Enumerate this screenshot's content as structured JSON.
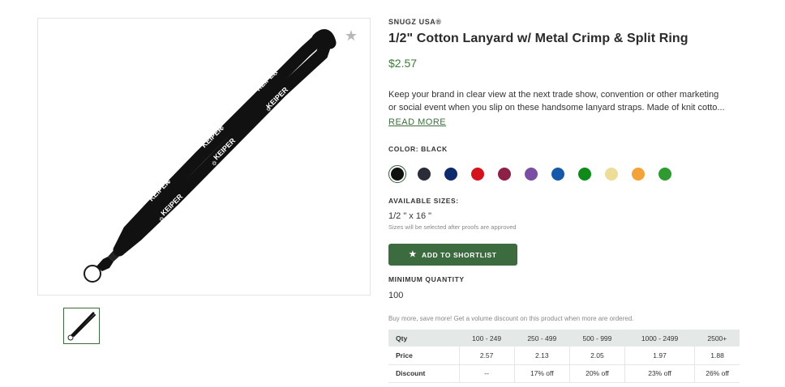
{
  "product": {
    "brand": "SNUGZ USA®",
    "title": "1/2\" Cotton Lanyard w/ Metal Crimp & Split Ring",
    "price": "$2.57",
    "description_line1": "Keep your brand in clear view at the next trade show, convention or other marketing",
    "description_line2": "or social event when you slip on these handsome lanyard straps. Made of knit cotto...",
    "read_more_label": "READ MORE",
    "imprint_text": "KEIPER",
    "favorite_icon": "star-icon",
    "lanyard_color": "#111111"
  },
  "color": {
    "label": "COLOR: BLACK",
    "swatches": [
      {
        "name": "black",
        "hex": "#111111",
        "selected": true
      },
      {
        "name": "dark-gray",
        "hex": "#2a2c38",
        "selected": false
      },
      {
        "name": "navy",
        "hex": "#0f2a6b",
        "selected": false
      },
      {
        "name": "red",
        "hex": "#d4131c",
        "selected": false
      },
      {
        "name": "maroon",
        "hex": "#8c2046",
        "selected": false
      },
      {
        "name": "purple",
        "hex": "#7a4ea3",
        "selected": false
      },
      {
        "name": "royal-blue",
        "hex": "#1659a8",
        "selected": false
      },
      {
        "name": "green",
        "hex": "#108a18",
        "selected": false
      },
      {
        "name": "khaki",
        "hex": "#eedd98",
        "selected": false
      },
      {
        "name": "orange",
        "hex": "#f4a23a",
        "selected": false
      },
      {
        "name": "kelly-green",
        "hex": "#2f9a2f",
        "selected": false
      }
    ]
  },
  "sizes": {
    "label": "AVAILABLE SIZES:",
    "value": "1/2 \" x 16 \"",
    "note": "Sizes will be selected after proofs are approved"
  },
  "shortlist": {
    "label": "ADD TO SHORTLIST",
    "icon": "star-icon"
  },
  "minimum": {
    "label": "MINIMUM QUANTITY",
    "value": "100"
  },
  "volume_note": "Buy more, save more! Get a volume discount on this product when more are ordered.",
  "pricing_table": {
    "header": [
      "Qty",
      "100 - 249",
      "250 - 499",
      "500 - 999",
      "1000 - 2499",
      "2500+"
    ],
    "rows": [
      [
        "Price",
        "2.57",
        "2.13",
        "2.05",
        "1.97",
        "1.88"
      ],
      [
        "Discount",
        "--",
        "17% off",
        "20% off",
        "23% off",
        "26% off"
      ]
    ]
  },
  "colors": {
    "accent_green": "#3b6b3e",
    "price_green": "#3e7a3a"
  }
}
